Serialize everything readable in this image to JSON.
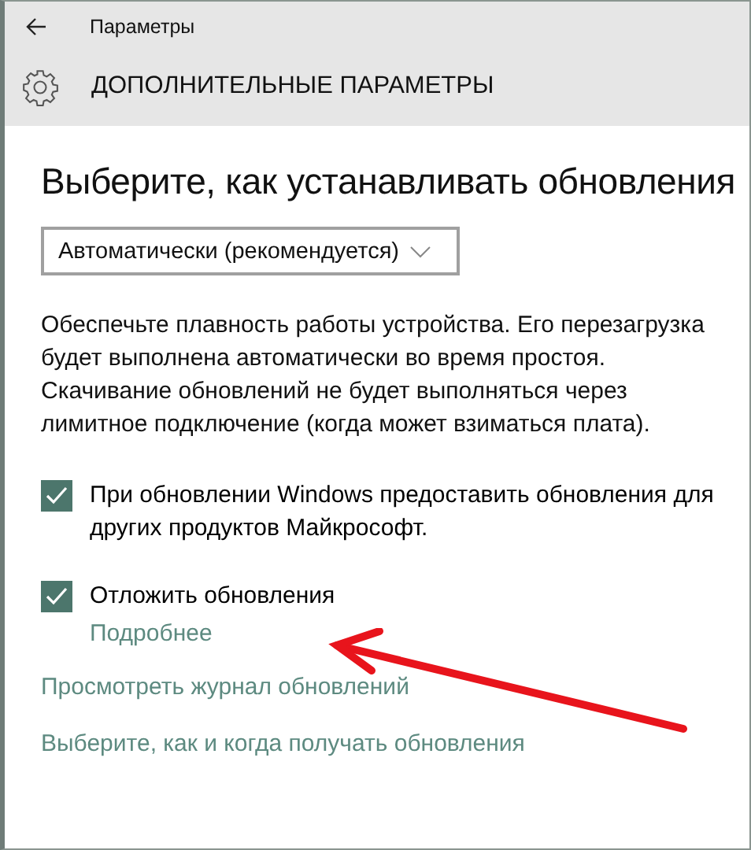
{
  "window": {
    "title": "Параметры"
  },
  "page": {
    "title": "ДОПОЛНИТЕЛЬНЫЕ ПАРАМЕТРЫ"
  },
  "section": {
    "heading": "Выберите, как устанавливать обновления"
  },
  "dropdown": {
    "value": "Автоматически (рекомендуется)"
  },
  "description": "Обеспечьте плавность работы устройства. Его перезагрузка будет выполнена автоматически во время простоя. Скачивание обновлений не будет выполняться через лимитное подключение (когда может взиматься плата).",
  "checkboxes": [
    {
      "label": "При обновлении Windows предоставить обновления для других продуктов Майкрософт.",
      "checked": true
    },
    {
      "label": "Отложить обновления",
      "checked": true,
      "link": "Подробнее"
    }
  ],
  "links": [
    "Просмотреть журнал обновлений",
    "Выберите, как и когда получать обновления"
  ],
  "annotation": {
    "kind": "arrow"
  }
}
